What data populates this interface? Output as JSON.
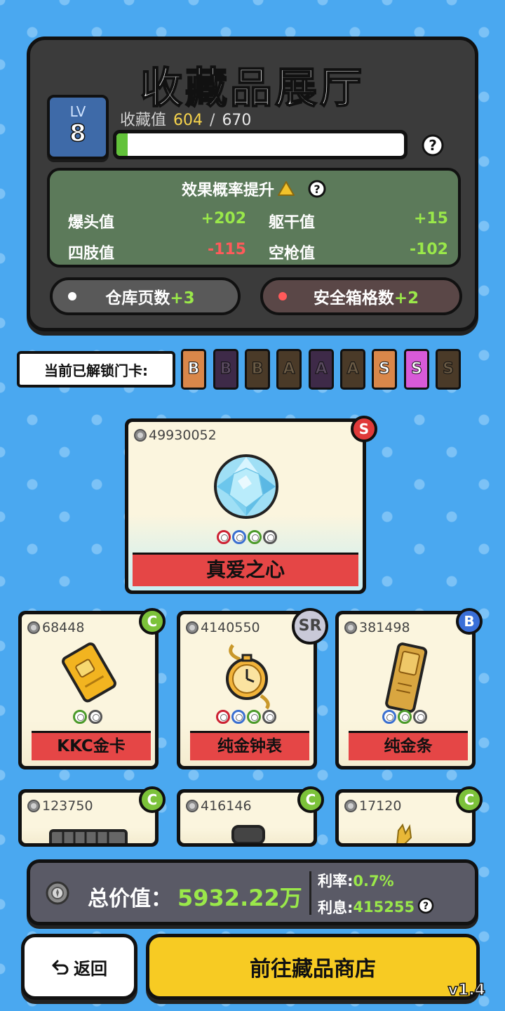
{
  "header": {
    "title": "收藏品展厅",
    "level_label": "LV",
    "level": "8",
    "collection_label": "收藏值",
    "collection_current": "604",
    "collection_separator": "/",
    "collection_max": "670",
    "collection_progress": 0.04
  },
  "effects": {
    "title": "效果概率提升",
    "stats": [
      {
        "label": "爆头值",
        "value": "+202"
      },
      {
        "label": "躯干值",
        "value": "+15"
      },
      {
        "label": "四肢值",
        "value": "-115"
      },
      {
        "label": "空枪值",
        "value": "-102"
      }
    ]
  },
  "bonuses": {
    "warehouse_label": "仓库页数",
    "warehouse_bonus": "+3",
    "safebox_label": "安全箱格数",
    "safebox_bonus": "+2"
  },
  "gates": {
    "label": "当前已解锁门卡:",
    "cards": [
      {
        "letter": "B",
        "bg": "#d9874a",
        "fg": "#ffffff",
        "unlocked": true
      },
      {
        "letter": "B",
        "bg": "#3e2a48",
        "fg": "#5a4a60",
        "unlocked": false
      },
      {
        "letter": "B",
        "bg": "#4a3a28",
        "fg": "#6a5a44",
        "unlocked": false
      },
      {
        "letter": "A",
        "bg": "#4a3a28",
        "fg": "#6a5a44",
        "unlocked": false
      },
      {
        "letter": "A",
        "bg": "#3e2a48",
        "fg": "#5a4a60",
        "unlocked": false
      },
      {
        "letter": "A",
        "bg": "#4a3a28",
        "fg": "#6a5a44",
        "unlocked": false
      },
      {
        "letter": "S",
        "bg": "#d9874a",
        "fg": "#ffffff",
        "unlocked": true
      },
      {
        "letter": "S",
        "bg": "#d85ad8",
        "fg": "#ffffff",
        "unlocked": true
      },
      {
        "letter": "S",
        "bg": "#4a3a28",
        "fg": "#6a5a44",
        "unlocked": false
      }
    ]
  },
  "featured": {
    "price": "49930052",
    "name": "真爱之心",
    "rarity": "S",
    "rarity_color": "#e03a3a",
    "icon": "diamond-gem-icon"
  },
  "items": [
    {
      "price": "68448",
      "name": "KKC金卡",
      "rarity": "C",
      "rarity_color": "#7cc23a",
      "icon": "gold-card-icon",
      "slots": [
        "green",
        "grey"
      ]
    },
    {
      "price": "4140550",
      "name": "纯金钟表",
      "rarity": "SR",
      "rarity_color": "#c9c9d8",
      "icon": "pocket-watch-icon",
      "slots": [
        "red",
        "blue",
        "green",
        "grey"
      ]
    },
    {
      "price": "381498",
      "name": "纯金条",
      "rarity": "B",
      "rarity_color": "#3a6fd8",
      "icon": "gold-bar-icon",
      "slots": [
        "blue",
        "green",
        "grey"
      ]
    },
    {
      "price": "123750",
      "name": "",
      "rarity": "C",
      "rarity_color": "#7cc23a",
      "icon": "gpu-icon"
    },
    {
      "price": "416146",
      "name": "",
      "rarity": "C",
      "rarity_color": "#7cc23a",
      "icon": "camera-icon"
    },
    {
      "price": "17120",
      "name": "",
      "rarity": "C",
      "rarity_color": "#7cc23a",
      "icon": "gold-statue-icon"
    }
  ],
  "summary": {
    "total_label": "总价值：",
    "total_value": "5932.22万",
    "rate_label": "利率:",
    "rate_value": "0.7%",
    "interest_label": "利息:",
    "interest_value": "415255"
  },
  "buttons": {
    "back": "返回",
    "shop": "前往藏品商店"
  },
  "version": "v1.4"
}
